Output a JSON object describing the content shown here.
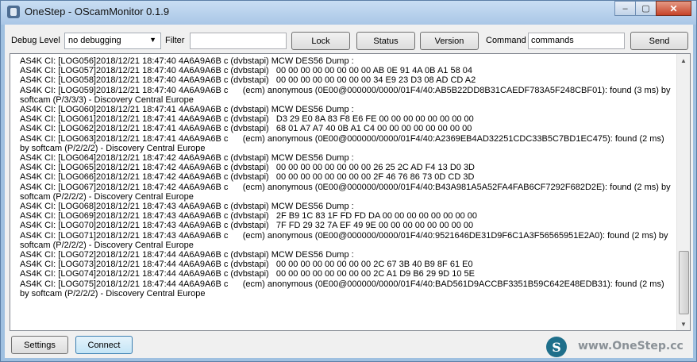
{
  "window": {
    "title": "OneStep - OScamMonitor 0.1.9",
    "minimize": "–",
    "maximize": "▢",
    "close": "✕"
  },
  "toolbar": {
    "debug_label": "Debug Level",
    "debug_value": "no debugging",
    "filter_label": "Filter",
    "filter_value": "",
    "lock": "Lock",
    "status": "Status",
    "version": "Version",
    "command_label": "Command",
    "command_value": "commands",
    "send": "Send"
  },
  "log": [
    "AS4K CI: [LOG056]2018/12/21 18:47:40 4A6A9A6B c (dvbstapi) MCW DES56 Dump :",
    "AS4K CI: [LOG057]2018/12/21 18:47:40 4A6A9A6B c (dvbstapi)   00 00 00 00 00 00 00 00 AB 0E 91 4A 0B A1 58 04",
    "AS4K CI: [LOG058]2018/12/21 18:47:40 4A6A9A6B c (dvbstapi)   00 00 00 00 00 00 00 00 34 E9 23 D3 08 AD CD A2",
    "AS4K CI: [LOG059]2018/12/21 18:47:40 4A6A9A6B c      (ecm) anonymous (0E00@000000/0000/01F4/40:AB5B22DD8B31CAEDF783A5F248CBF01): found (3 ms) by softcam (P/3/3/3) - Discovery Central Europe",
    "AS4K CI: [LOG060]2018/12/21 18:47:41 4A6A9A6B c (dvbstapi) MCW DES56 Dump :",
    "AS4K CI: [LOG061]2018/12/21 18:47:41 4A6A9A6B c (dvbstapi)   D3 29 E0 8A 83 F8 E6 FE 00 00 00 00 00 00 00 00",
    "AS4K CI: [LOG062]2018/12/21 18:47:41 4A6A9A6B c (dvbstapi)   68 01 A7 A7 40 0B A1 C4 00 00 00 00 00 00 00 00",
    "AS4K CI: [LOG063]2018/12/21 18:47:41 4A6A9A6B c      (ecm) anonymous (0E00@000000/0000/01F4/40:A2369EB4AD32251CDC33B5C7BD1EC475): found (2 ms) by softcam (P/2/2/2) - Discovery Central Europe",
    "AS4K CI: [LOG064]2018/12/21 18:47:42 4A6A9A6B c (dvbstapi) MCW DES56 Dump :",
    "AS4K CI: [LOG065]2018/12/21 18:47:42 4A6A9A6B c (dvbstapi)   00 00 00 00 00 00 00 00 26 25 2C AD F4 13 D0 3D",
    "AS4K CI: [LOG066]2018/12/21 18:47:42 4A6A9A6B c (dvbstapi)   00 00 00 00 00 00 00 00 2F 46 76 86 73 0D CD 3D",
    "AS4K CI: [LOG067]2018/12/21 18:47:42 4A6A9A6B c      (ecm) anonymous (0E00@000000/0000/01F4/40:B43A981A5A52FA4FAB6CF7292F682D2E): found (2 ms) by softcam (P/2/2/2) - Discovery Central Europe",
    "AS4K CI: [LOG068]2018/12/21 18:47:43 4A6A9A6B c (dvbstapi) MCW DES56 Dump :",
    "AS4K CI: [LOG069]2018/12/21 18:47:43 4A6A9A6B c (dvbstapi)   2F B9 1C 83 1F FD FD DA 00 00 00 00 00 00 00 00",
    "AS4K CI: [LOG070]2018/12/21 18:47:43 4A6A9A6B c (dvbstapi)   7F FD 29 32 7A EF 49 9E 00 00 00 00 00 00 00 00",
    "AS4K CI: [LOG071]2018/12/21 18:47:43 4A6A9A6B c      (ecm) anonymous (0E00@000000/0000/01F4/40:9521646DE31D9F6C1A3F56565951E2A0): found (2 ms) by softcam (P/2/2/2) - Discovery Central Europe",
    "AS4K CI: [LOG072]2018/12/21 18:47:44 4A6A9A6B c (dvbstapi) MCW DES56 Dump :",
    "AS4K CI: [LOG073]2018/12/21 18:47:44 4A6A9A6B c (dvbstapi)   00 00 00 00 00 00 00 00 2C 67 3B 40 B9 8F 61 E0",
    "AS4K CI: [LOG074]2018/12/21 18:47:44 4A6A9A6B c (dvbstapi)   00 00 00 00 00 00 00 00 2C A1 D9 B6 29 9D 10 5E",
    "AS4K CI: [LOG075]2018/12/21 18:47:44 4A6A9A6B c      (ecm) anonymous (0E00@000000/0000/01F4/40:BAD561D9ACCBF3351B59C642E48EDB31): found (2 ms) by softcam (P/2/2/2) - Discovery Central Europe"
  ],
  "bottom": {
    "settings": "Settings",
    "connect": "Connect",
    "logo_letter": "S",
    "logo_text": "www.OneStep.cc"
  }
}
